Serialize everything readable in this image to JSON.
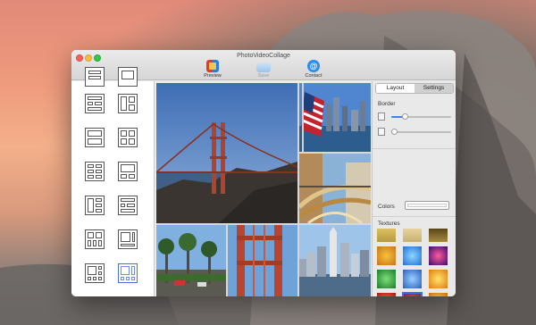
{
  "window": {
    "title": "PhotoVideoCollage"
  },
  "toolbar": {
    "preview_label": "Preview",
    "save_label": "Save",
    "contact_label": "Contact",
    "contact_icon_glyph": "@"
  },
  "templates": [
    {
      "id": "grid-partial-1"
    },
    {
      "id": "grid-partial-2"
    },
    {
      "id": "rows-left-blocks"
    },
    {
      "id": "col-split-right"
    },
    {
      "id": "two-rows"
    },
    {
      "id": "two-by-two"
    },
    {
      "id": "six-grid"
    },
    {
      "id": "big-small-bottom"
    },
    {
      "id": "three-rows-split"
    },
    {
      "id": "cross-layout"
    },
    {
      "id": "four-grid-small"
    },
    {
      "id": "bottom-wide"
    },
    {
      "id": "corner-big"
    },
    {
      "id": "selected-grid"
    }
  ],
  "right_panel": {
    "tab_layout": "Layout",
    "tab_settings": "Settings",
    "active_tab": "Settings",
    "border_label": "Border",
    "slider_1_value": 0.22,
    "slider_2_value": 0.05,
    "colors_label": "Colors",
    "textures_label": "Textures"
  },
  "colors": {
    "accent": "#3a86f0",
    "selection": "#3c6ee8"
  },
  "photos": [
    {
      "name": "golden-gate-bridge"
    },
    {
      "name": "flag-and-city"
    },
    {
      "name": "building-sculpture"
    },
    {
      "name": "palm-street"
    },
    {
      "name": "bridge-tower"
    },
    {
      "name": "city-skyline"
    }
  ]
}
